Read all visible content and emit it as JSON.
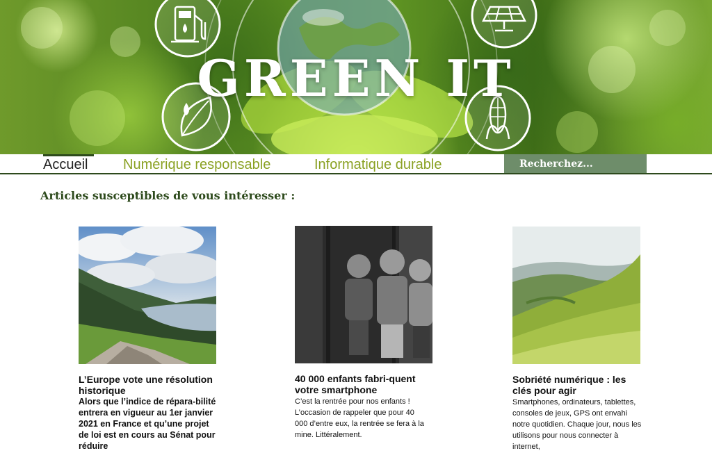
{
  "header": {
    "title": "GREEN IT",
    "icons": [
      "fuel-pump-icon",
      "globe-icon",
      "solar-panel-icon",
      "leaf-drop-icon",
      "corn-icon"
    ]
  },
  "nav": {
    "items": [
      {
        "label": "Accueil",
        "active": true
      },
      {
        "label": "Numérique responsable",
        "active": false
      },
      {
        "label": "Informatique durable",
        "active": false
      }
    ],
    "search_placeholder": "Recherchez..."
  },
  "section": {
    "heading": "Articles susceptibles de vous intéresser :"
  },
  "articles": [
    {
      "title": "L’Europe vote une résolution historique",
      "excerpt": "Alors que l’indice de répara-bilité entrera en vigueur au 1er janvier 2021 en France et qu’une projet de loi est en cours au Sénat pour réduire",
      "image": "lake-valley-landscape"
    },
    {
      "title": "40 000 enfants fabri-quent votre smartphone",
      "excerpt": "C’est la rentrée pour nos enfants ! L’occasion de rappeler que pour 40 000 d’entre eux, la rentrée se fera à la mine. Littéralement.",
      "image": "three-children-black-and-white"
    },
    {
      "title": "Sobriété numérique : les clés pour agir",
      "excerpt": "Smartphones, ordinateurs, tablettes, consoles de jeux, GPS ont envahi notre quotidien. Chaque jour, nous les utilisons pour nous connecter à internet,",
      "image": "green-hills-landscape"
    }
  ],
  "colors": {
    "brand_dark_green": "#2d4a1c",
    "nav_link_olive": "#8aa123",
    "search_bg": "#6e8d6a"
  }
}
